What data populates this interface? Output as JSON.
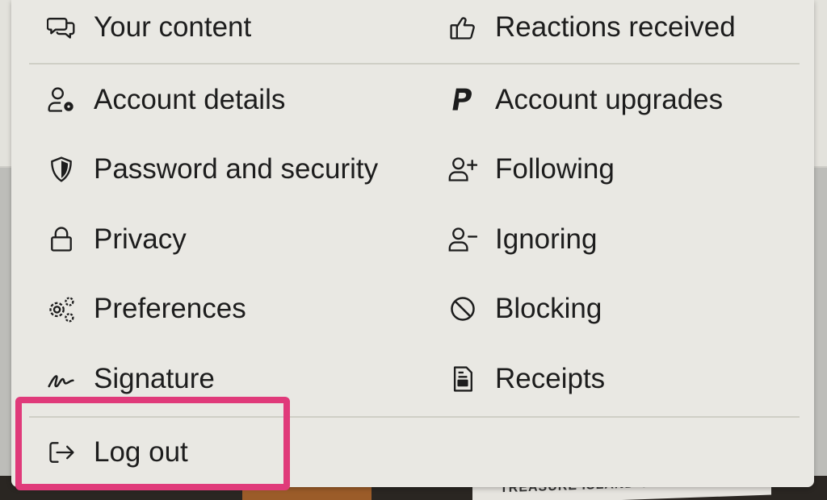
{
  "background": {
    "sign_text": "TREASURE ISLAND CASINO"
  },
  "menu": {
    "top_row": [
      {
        "label": "Your content",
        "icon": "comments-icon"
      },
      {
        "label": "Reactions received",
        "icon": "thumbs-up-icon"
      }
    ],
    "left_items": [
      {
        "label": "Account details",
        "icon": "user-cog-icon"
      },
      {
        "label": "Password and security",
        "icon": "shield-icon"
      },
      {
        "label": "Privacy",
        "icon": "lock-icon"
      },
      {
        "label": "Preferences",
        "icon": "gears-icon"
      },
      {
        "label": "Signature",
        "icon": "signature-icon"
      }
    ],
    "right_items": [
      {
        "label": "Account upgrades",
        "icon": "paypal-icon"
      },
      {
        "label": "Following",
        "icon": "user-plus-icon"
      },
      {
        "label": "Ignoring",
        "icon": "user-minus-icon"
      },
      {
        "label": "Blocking",
        "icon": "ban-icon"
      },
      {
        "label": "Receipts",
        "icon": "receipt-icon"
      }
    ],
    "logout": {
      "label": "Log out",
      "icon": "sign-out-icon"
    }
  },
  "colors": {
    "menu_bg": "#e9e8e3",
    "highlight": "#e03a7a",
    "text": "#1d1d1d"
  }
}
